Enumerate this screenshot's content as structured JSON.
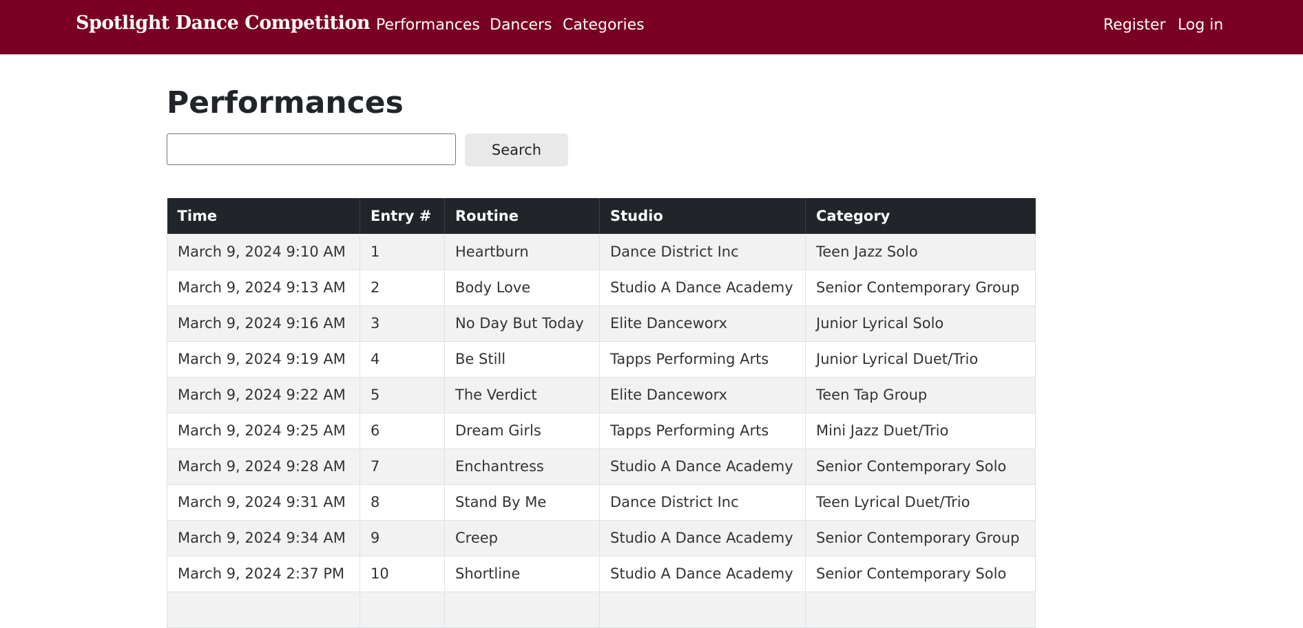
{
  "navbar": {
    "brand": "Spotlight Dance Competition",
    "links": [
      "Performances",
      "Dancers",
      "Categories"
    ],
    "register": "Register",
    "login": "Log in",
    "background_color": "#7a0022"
  },
  "page": {
    "title": "Performances"
  },
  "search": {
    "value": "",
    "button_label": "Search"
  },
  "table": {
    "columns": [
      "Time",
      "Entry #",
      "Routine",
      "Studio",
      "Category"
    ],
    "rows": [
      [
        "March 9, 2024 9:10 AM",
        "1",
        "Heartburn",
        "Dance District Inc",
        "Teen Jazz Solo"
      ],
      [
        "March 9, 2024 9:13 AM",
        "2",
        "Body Love",
        "Studio A Dance Academy",
        "Senior Contemporary Group"
      ],
      [
        "March 9, 2024 9:16 AM",
        "3",
        "No Day But Today",
        "Elite Danceworx",
        "Junior Lyrical Solo"
      ],
      [
        "March 9, 2024 9:19 AM",
        "4",
        "Be Still",
        "Tapps Performing Arts",
        "Junior Lyrical Duet/Trio"
      ],
      [
        "March 9, 2024 9:22 AM",
        "5",
        "The Verdict",
        "Elite Danceworx",
        "Teen Tap Group"
      ],
      [
        "March 9, 2024 9:25 AM",
        "6",
        "Dream Girls",
        "Tapps Performing Arts",
        "Mini Jazz Duet/Trio"
      ],
      [
        "March 9, 2024 9:28 AM",
        "7",
        "Enchantress",
        "Studio A Dance Academy",
        "Senior Contemporary Solo"
      ],
      [
        "March 9, 2024 9:31 AM",
        "8",
        "Stand By Me",
        "Dance District Inc",
        "Teen Lyrical Duet/Trio"
      ],
      [
        "March 9, 2024 9:34 AM",
        "9",
        "Creep",
        "Studio A Dance Academy",
        "Senior Contemporary Group"
      ],
      [
        "March 9, 2024 2:37 PM",
        "10",
        "Shortline",
        "Studio A Dance Academy",
        "Senior Contemporary Solo"
      ],
      [
        "",
        "",
        "",
        "",
        ""
      ]
    ]
  }
}
